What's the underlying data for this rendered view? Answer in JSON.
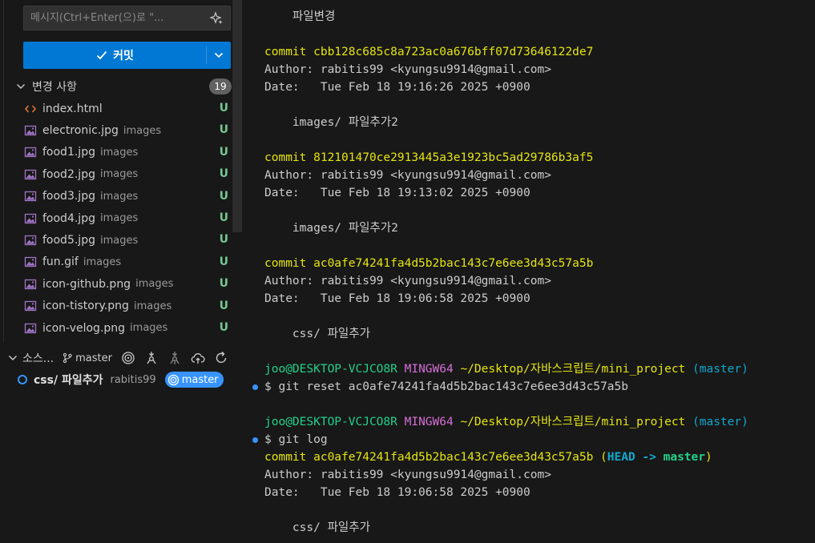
{
  "scm": {
    "message_placeholder": "메시지(Ctrl+Enter(으)로 \"...",
    "commit_label": "커밋",
    "changes_title": "변경 사항",
    "changes_count": "19",
    "files": [
      {
        "name": "index.html",
        "dir": "",
        "status": "U",
        "icon": "html-icon"
      },
      {
        "name": "electronic.jpg",
        "dir": "images",
        "status": "U",
        "icon": "image-icon"
      },
      {
        "name": "food1.jpg",
        "dir": "images",
        "status": "U",
        "icon": "image-icon"
      },
      {
        "name": "food2.jpg",
        "dir": "images",
        "status": "U",
        "icon": "image-icon"
      },
      {
        "name": "food3.jpg",
        "dir": "images",
        "status": "U",
        "icon": "image-icon"
      },
      {
        "name": "food4.jpg",
        "dir": "images",
        "status": "U",
        "icon": "image-icon"
      },
      {
        "name": "food5.jpg",
        "dir": "images",
        "status": "U",
        "icon": "image-icon"
      },
      {
        "name": "fun.gif",
        "dir": "images",
        "status": "U",
        "icon": "image-icon"
      },
      {
        "name": "icon-github.png",
        "dir": "images",
        "status": "U",
        "icon": "image-icon"
      },
      {
        "name": "icon-tistory.png",
        "dir": "images",
        "status": "U",
        "icon": "image-icon"
      },
      {
        "name": "icon-velog.png",
        "dir": "images",
        "status": "U",
        "icon": "image-icon"
      }
    ],
    "graph_title": "소스...",
    "graph_branch": "master",
    "graph_commit": {
      "message": "css/ 파일추가",
      "author": "rabitis99",
      "branch": "master"
    }
  },
  "terminal": {
    "lines": [
      {
        "text": "    파일변경"
      },
      {
        "text": ""
      },
      {
        "commit": "commit cbb128c685c8a723ac0a676bff07d73646122de7"
      },
      {
        "text": "Author: rabitis99 <kyungsu9914@gmail.com>"
      },
      {
        "text": "Date:   Tue Feb 18 19:16:26 2025 +0900"
      },
      {
        "text": ""
      },
      {
        "text": "    images/ 파일추가2"
      },
      {
        "text": ""
      },
      {
        "commit": "commit 812101470ce2913445a3e1923bc5ad29786b3af5"
      },
      {
        "text": "Author: rabitis99 <kyungsu9914@gmail.com>"
      },
      {
        "text": "Date:   Tue Feb 18 19:13:02 2025 +0900"
      },
      {
        "text": ""
      },
      {
        "text": "    images/ 파일추가2"
      },
      {
        "text": ""
      },
      {
        "commit": "commit ac0afe74241fa4d5b2bac143c7e6ee3d43c57a5b"
      },
      {
        "text": "Author: rabitis99 <kyungsu9914@gmail.com>"
      },
      {
        "text": "Date:   Tue Feb 18 19:06:58 2025 +0900"
      },
      {
        "text": ""
      },
      {
        "text": "    css/ 파일추가"
      },
      {
        "text": ""
      },
      {
        "prompt": {
          "user": "joo@DESKTOP-VCJCO8R",
          "shell": "MINGW64",
          "path": "~/Desktop/자바스크립트/mini_project",
          "branch": "(master)"
        }
      },
      {
        "cmd": "$ git reset ac0afe74241fa4d5b2bac143c7e6ee3d43c57a5b"
      },
      {
        "text": ""
      },
      {
        "prompt": {
          "user": "joo@DESKTOP-VCJCO8R",
          "shell": "MINGW64",
          "path": "~/Desktop/자바스크립트/mini_project",
          "branch": "(master)"
        }
      },
      {
        "cmd": "$ git log"
      },
      {
        "commit": "commit ac0afe74241fa4d5b2bac143c7e6ee3d43c57a5b",
        "head": "HEAD",
        "arrow": " -> ",
        "ref": "master"
      },
      {
        "text": "Author: rabitis99 <kyungsu9914@gmail.com>"
      },
      {
        "text": "Date:   Tue Feb 18 19:06:58 2025 +0900"
      },
      {
        "text": ""
      },
      {
        "text": "    css/ 파일추가"
      }
    ]
  },
  "colors": {
    "accent": "#0078d4",
    "untracked": "#73c991",
    "commit_yellow": "#e5e510",
    "prompt_green": "#23d18b",
    "prompt_magenta": "#d670d6",
    "prompt_cyan": "#11a8cd"
  }
}
